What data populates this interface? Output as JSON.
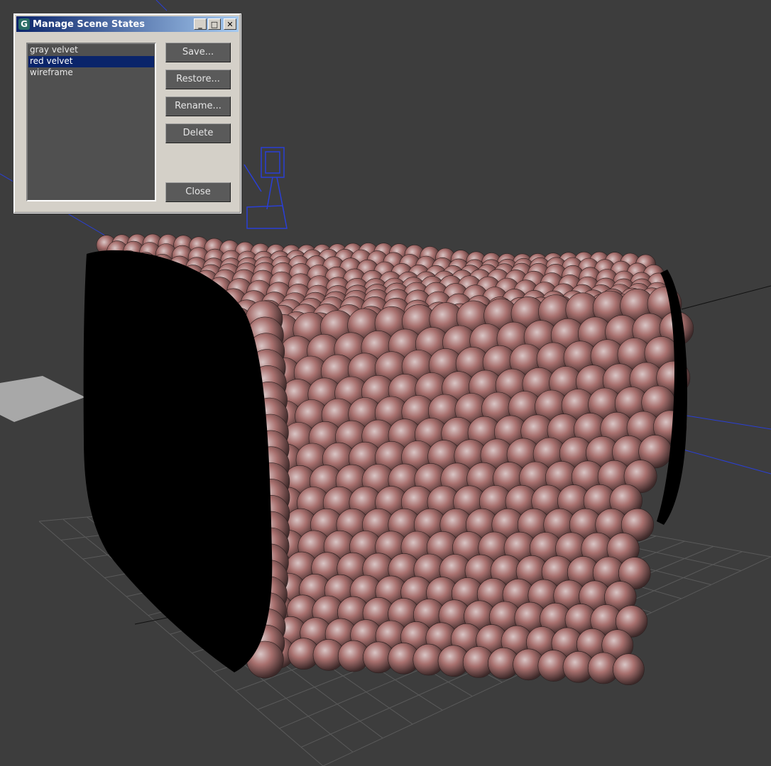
{
  "dialog": {
    "title": "Manage Scene States",
    "app_icon_glyph": "G",
    "minimize_glyph": "_",
    "maximize_glyph": "□",
    "close_glyph": "✕",
    "scene_states": [
      "gray velvet",
      "red velvet",
      "wireframe"
    ],
    "selected_index": 1,
    "buttons": {
      "save": "Save...",
      "restore": "Restore...",
      "rename": "Rename...",
      "delete": "Delete",
      "close": "Close"
    }
  },
  "colors": {
    "viewport_bg": "#3d3d3d",
    "selection": "#0a246a",
    "helper_blue": "#2a3fd6",
    "sphere_red": "#a86a6a"
  }
}
